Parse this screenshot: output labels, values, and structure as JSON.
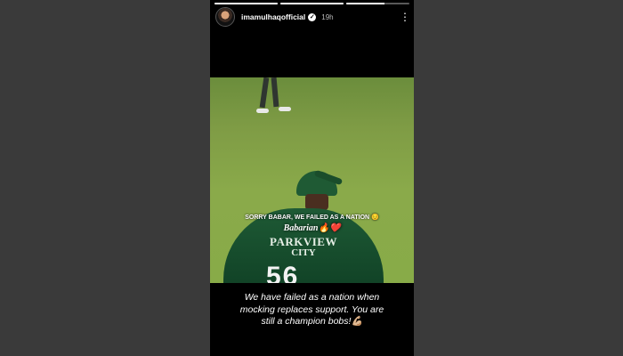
{
  "story": {
    "progress_segments": [
      1,
      1,
      0.6
    ],
    "username": "imamulhaqofficial",
    "time": "19h",
    "verified_icon": "verified-badge-icon",
    "more_icon": "more-options-icon"
  },
  "media": {
    "overlay_line1": "SORRY BABAR, WE FAILED AS A NATION 😔",
    "overlay_line2": "Babarian🔥❤️",
    "jersey_sponsor_line1": "PARKVIEW",
    "jersey_sponsor_line2": "CITY",
    "jersey_number": "56"
  },
  "caption": "We have failed as a nation when mocking replaces support. You are still a champion bobs!💪🏼"
}
